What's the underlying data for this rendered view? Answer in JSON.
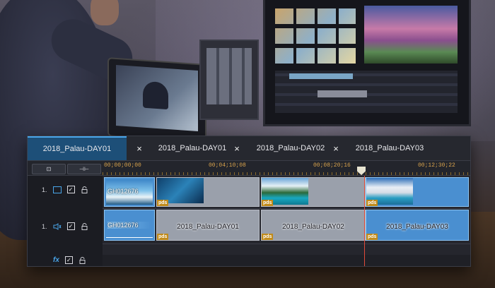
{
  "tabs": [
    {
      "label": "2018_Palau-DAY01",
      "active": true
    },
    {
      "label": "2018_Palau-DAY01",
      "active": false
    },
    {
      "label": "2018_Palau-DAY02",
      "active": false
    },
    {
      "label": "2018_Palau-DAY03",
      "active": false
    }
  ],
  "tab_close_glyph": "×",
  "toolbar": {
    "btn1": "⊡",
    "btn2": "⊣⊢"
  },
  "ruler": [
    "00;00;00;00",
    "00;04;10;08",
    "00;08;20;16",
    "00;12;30;22"
  ],
  "tracks": {
    "video": {
      "label": "1.",
      "icon": "video-icon",
      "checked": "✓",
      "lock": "🔓"
    },
    "audio": {
      "label": "1.",
      "icon": "audio-icon",
      "checked": "✓",
      "lock": "🔓"
    },
    "fx": {
      "label": "fx",
      "checked": "✓",
      "lock": "🔓"
    }
  },
  "clips": {
    "c1_video_name": "GH012676",
    "c1_audio_name": "GH012676",
    "c2_name": "2018_Palau-DAY01",
    "c3_name": "2018_Palau-DAY02",
    "c4_name": "2018_Palau-DAY03",
    "badge": "pds"
  },
  "colors": {
    "active_tab": "#1d4f78",
    "selected_clip": "#4a8fd0",
    "playhead": "#e04a3a",
    "ruler_text": "#d7a24c"
  }
}
